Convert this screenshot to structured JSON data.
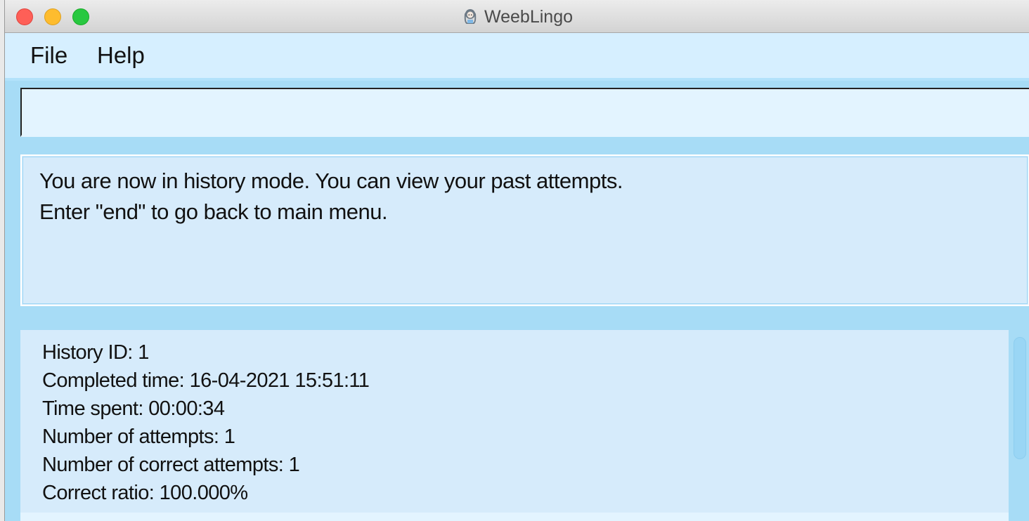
{
  "window": {
    "title": "WeebLingo",
    "icon": "app-character-icon"
  },
  "menu": {
    "file": "File",
    "help": "Help"
  },
  "command_box": {
    "value": "",
    "placeholder": ""
  },
  "result_display": {
    "lines": [
      "You are now in history mode. You can view your past attempts.",
      "Enter \"end\" to go back to main menu."
    ]
  },
  "history": {
    "entries": [
      {
        "history_id": "History ID: 1",
        "completed_time": "Completed time: 16-04-2021 15:51:11",
        "time_spent": "Time spent: 00:00:34",
        "attempts": "Number of attempts: 1",
        "correct_attempts": "Number of correct attempts: 1",
        "correct_ratio": "Correct ratio: 100.000%"
      }
    ]
  },
  "colors": {
    "background": "#d6efff",
    "band": "#a7dcf6",
    "card": "#d6ebfb",
    "close": "#fe5f57",
    "minimize": "#febc2e",
    "maximize": "#28c840"
  }
}
